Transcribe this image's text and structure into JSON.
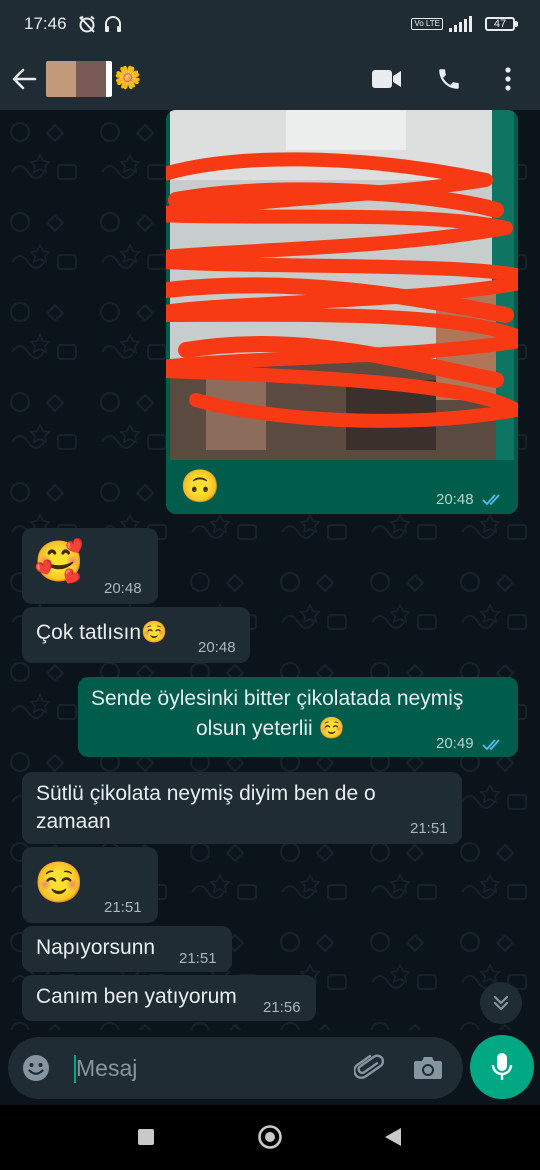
{
  "status_bar": {
    "time": "17:46",
    "network_label": "Vo LTE",
    "battery": "47"
  },
  "header": {
    "contact_emoji": "🌼"
  },
  "messages": [
    {
      "id": "m1",
      "direction": "out",
      "type": "image",
      "caption_emoji": "🙃",
      "time": "20:48",
      "status": "read"
    },
    {
      "id": "m2",
      "direction": "in",
      "type": "emoji",
      "text": "🥰",
      "time": "20:48"
    },
    {
      "id": "m3",
      "direction": "in",
      "type": "text",
      "text": "Çok tatlısın☺️",
      "time": "20:48"
    },
    {
      "id": "m4",
      "direction": "out",
      "type": "text",
      "text_line1": "Sende öylesinki bitter çikolatada neymiş",
      "text_line2": "olsun yeterlii ☺️",
      "time": "20:49",
      "status": "read"
    },
    {
      "id": "m5",
      "direction": "in",
      "type": "text",
      "text_line1": "Sütlü çikolata neymiş diyim ben de o",
      "text_line2": "zamaan",
      "time": "21:51"
    },
    {
      "id": "m6",
      "direction": "in",
      "type": "emoji",
      "text": "☺️",
      "time": "21:51"
    },
    {
      "id": "m7",
      "direction": "in",
      "type": "text",
      "text": "Napıyorsunn",
      "time": "21:51"
    },
    {
      "id": "m8",
      "direction": "in",
      "type": "text",
      "text": "Canım ben yatıyorum",
      "time": "21:56"
    }
  ],
  "composer": {
    "placeholder": "Mesaj"
  },
  "colors": {
    "chat_bg": "#0b141a",
    "bar_bg": "#1f2c34",
    "incoming_bubble": "#1f2c34",
    "outgoing_bubble": "#005c4b",
    "accent": "#00a884",
    "read_ticks": "#53bdeb",
    "scribble": "#f83a14"
  },
  "icons": {
    "back": "arrow-left-icon",
    "video": "video-camera-icon",
    "call": "phone-icon",
    "menu": "more-vertical-icon",
    "emoji": "smiley-icon",
    "attach": "paperclip-icon",
    "camera": "camera-icon",
    "mic": "microphone-icon",
    "scroll": "double-chevron-down-icon"
  }
}
